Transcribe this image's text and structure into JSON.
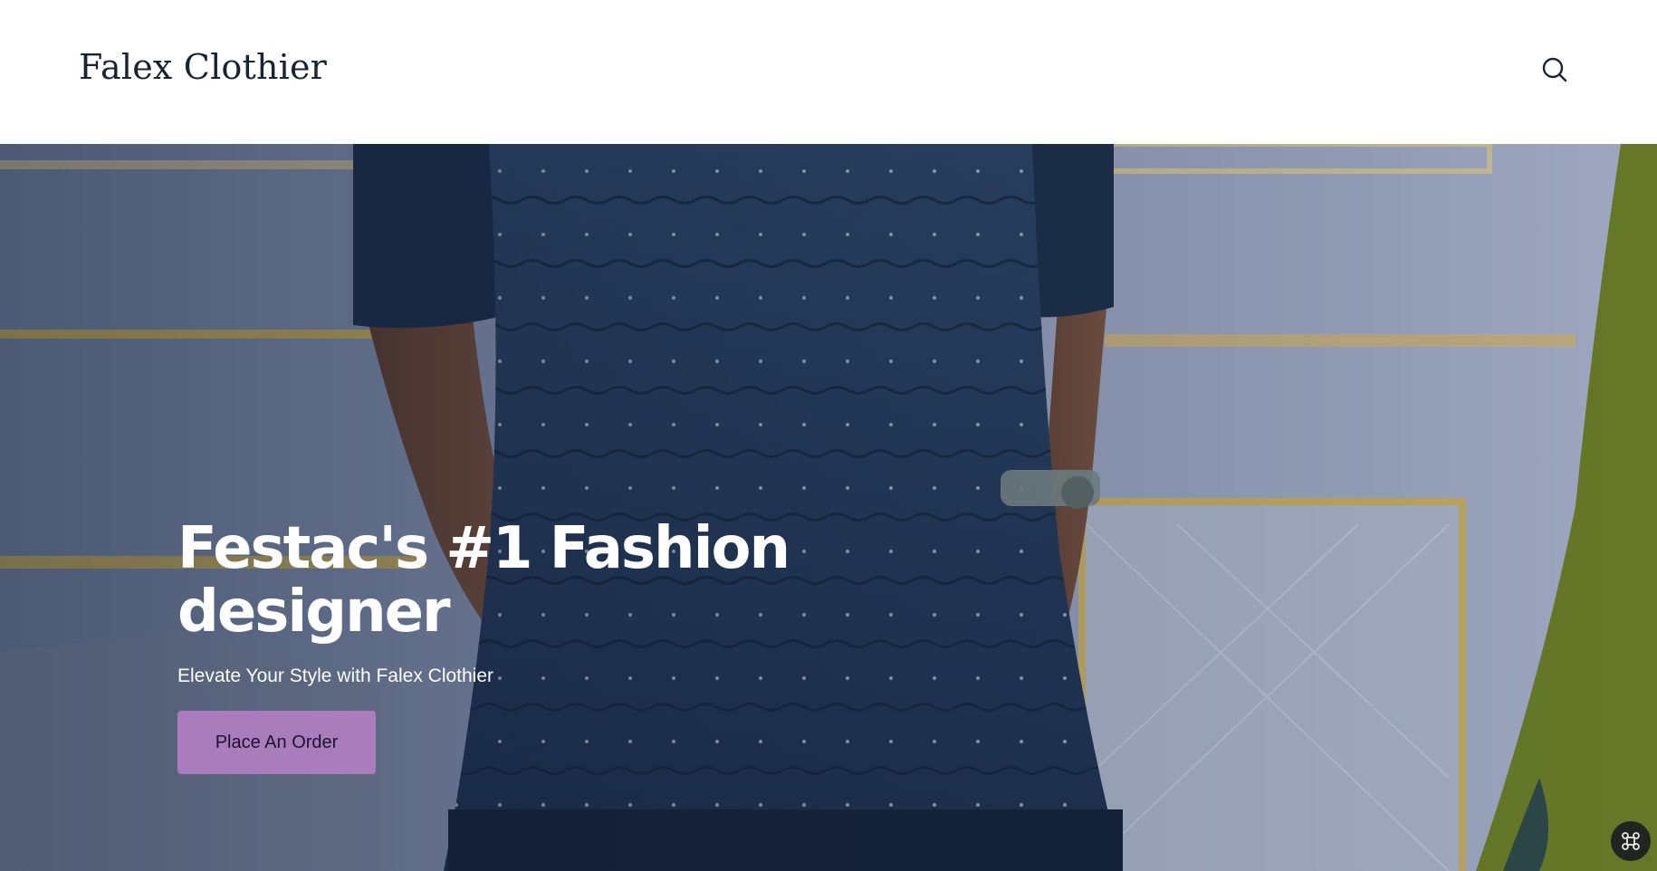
{
  "header": {
    "brand": "Falex Clothier",
    "search_icon": "search-icon"
  },
  "hero": {
    "headline": "Festac's #1 Fashion designer",
    "subtitle": "Elevate Your Style with Falex Clothier",
    "cta_label": "Place An Order",
    "background_image": "model-in-navy-textured-shirt-photo"
  },
  "widget": {
    "icon": "command-icon"
  },
  "colors": {
    "cta_background": "#a97dbc",
    "brand_text": "#1a2233",
    "header_background": "#ffffff"
  }
}
